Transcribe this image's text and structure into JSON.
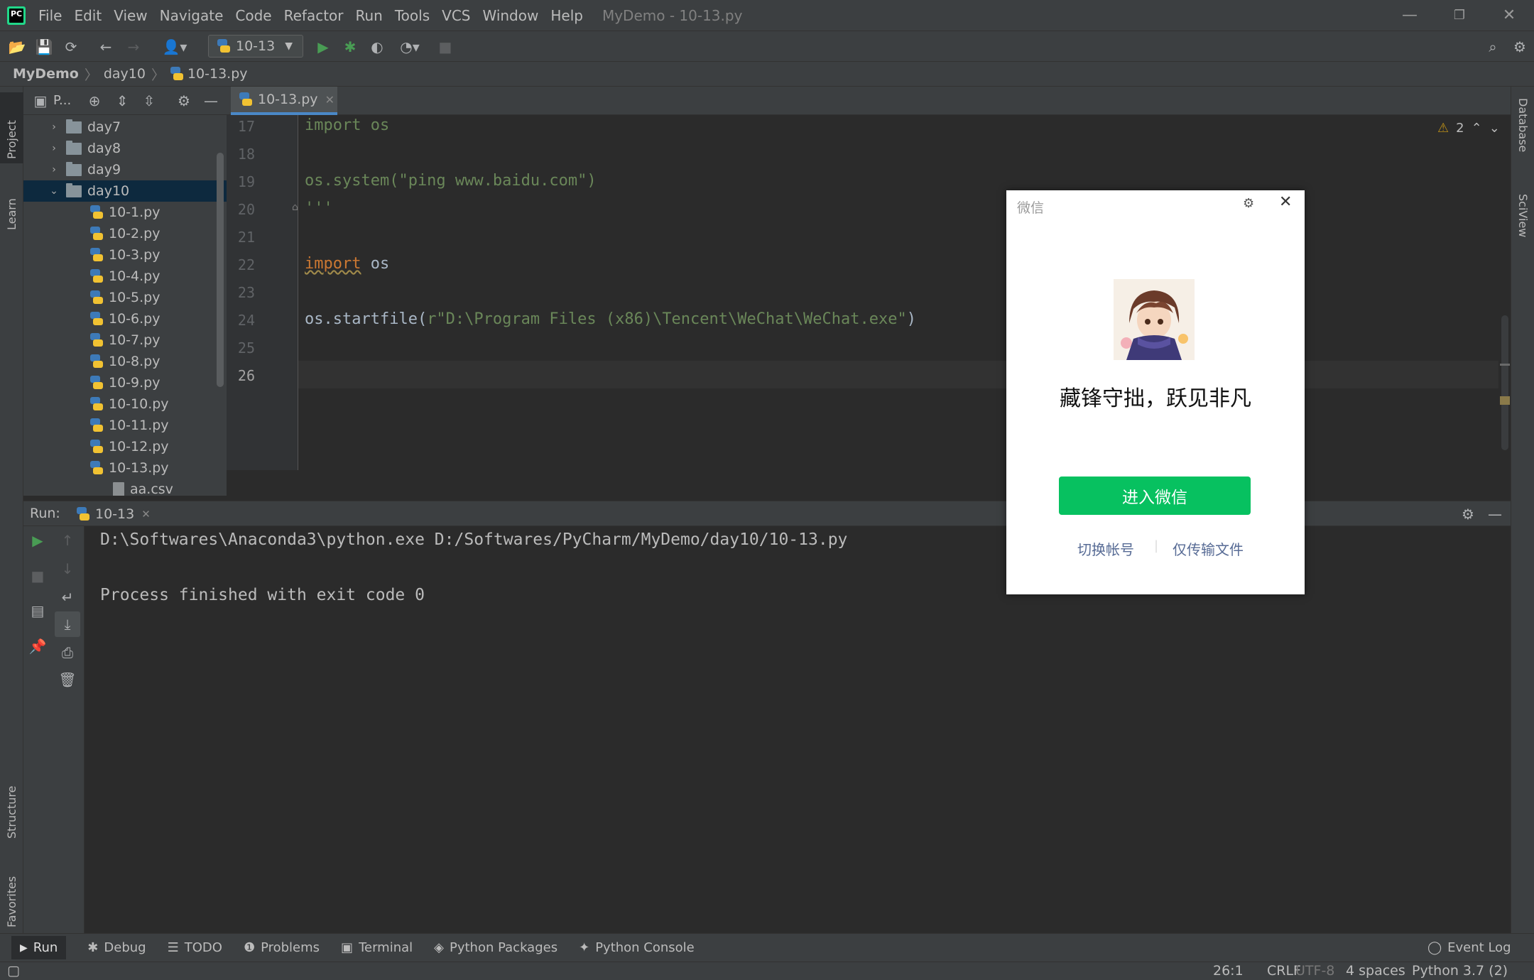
{
  "menubar": {
    "items": [
      "File",
      "Edit",
      "View",
      "Navigate",
      "Code",
      "Refactor",
      "Run",
      "Tools",
      "VCS",
      "Window",
      "Help"
    ],
    "window_title": "MyDemo - 10-13.py"
  },
  "toolbar": {
    "run_config": "10-13"
  },
  "breadcrumb": {
    "project": "MyDemo",
    "folder": "day10",
    "file": "10-13.py"
  },
  "left_strip": {
    "project": "Project",
    "learn": "Learn",
    "structure": "Structure",
    "favorites": "Favorites"
  },
  "right_strip": {
    "database": "Database",
    "sciview": "SciView"
  },
  "project_panel": {
    "title": "P...",
    "folders": [
      "day7",
      "day8",
      "day9",
      "day10"
    ],
    "files": [
      "10-1.py",
      "10-2.py",
      "10-3.py",
      "10-4.py",
      "10-5.py",
      "10-6.py",
      "10-7.py",
      "10-8.py",
      "10-9.py",
      "10-10.py",
      "10-11.py",
      "10-12.py",
      "10-13.py",
      "aa.csv"
    ]
  },
  "editor": {
    "tab": "10-13.py",
    "warnings": "2",
    "line_numbers": [
      "17",
      "18",
      "19",
      "20",
      "21",
      "22",
      "23",
      "24",
      "25",
      "26"
    ],
    "lines": {
      "l17": "import os",
      "l19": "os.system(\"ping www.baidu.com\")",
      "l20": "'''",
      "l22_kw": "import",
      "l22_mod": " os",
      "l24_fn": "os.startfile(",
      "l24_str": "r\"D:\\Program Files (x86)\\Tencent\\WeChat\\WeChat.exe\"",
      "l24_end": ")"
    }
  },
  "run_panel": {
    "label": "Run:",
    "tab": "10-13",
    "output": [
      "D:\\Softwares\\Anaconda3\\python.exe D:/Softwares/PyCharm/MyDemo/day10/10-13.py",
      "Process finished with exit code 0"
    ]
  },
  "bottom_tabs": [
    "Run",
    "Debug",
    "TODO",
    "Problems",
    "Terminal",
    "Python Packages",
    "Python Console"
  ],
  "event_log": "Event Log",
  "status": {
    "position": "26:1",
    "line_sep": "CRLF",
    "encoding": "UTF-8",
    "indent": "4 spaces",
    "interpreter": "Python 3.7 (2)"
  },
  "wechat": {
    "title": "微信",
    "slogan": "藏锋守拙，跃见非凡",
    "enter_button": "进入微信",
    "switch_account": "切换帐号",
    "file_only": "仅传输文件",
    "brand_color": "#07c160"
  },
  "colors": {
    "keyword": "#cc7832",
    "string": "#6a8759",
    "accent": "#4a88c7",
    "run_green": "#499c54"
  }
}
